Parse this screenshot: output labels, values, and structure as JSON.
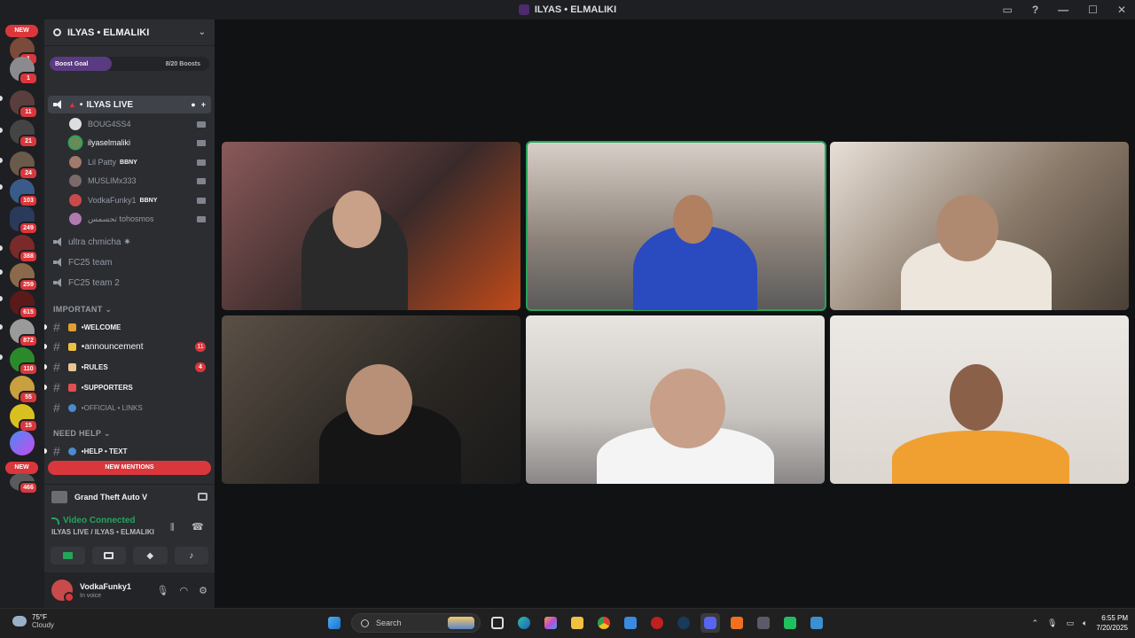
{
  "window": {
    "title": "ILYAS • ELMALIKI"
  },
  "guilds": {
    "new_top": "NEW",
    "new_bottom": "NEW",
    "badges": [
      "1",
      "1",
      "11",
      "21",
      "24",
      "103",
      "249",
      "388",
      "259",
      "615",
      "872",
      "110",
      "55",
      "15",
      "466"
    ]
  },
  "server": {
    "name": "ILYAS • ELMALIKI",
    "boost_label": "Boost Goal",
    "boost_count": "8/20 Boosts",
    "boost_progress": 0.4
  },
  "voice_channel": {
    "name": "ILYAS LIVE",
    "users": [
      {
        "name": "BOUG4SS4",
        "tag": ""
      },
      {
        "name": "ilyaselmaliki",
        "tag": ""
      },
      {
        "name": "Lil Patty",
        "tag": "BBNY"
      },
      {
        "name": "MUSLIMx333",
        "tag": ""
      },
      {
        "name": "VodkaFunky1",
        "tag": "BBNY"
      },
      {
        "name": "تحسمس tohosmos",
        "tag": ""
      }
    ]
  },
  "other_voice": [
    "ultra chmicha ✷",
    "FC25 team",
    "FC25 team 2"
  ],
  "categories": {
    "important": "IMPORTANT",
    "need_help": "NEED HELP"
  },
  "text_channels": [
    {
      "name": "WELCOME",
      "badge": ""
    },
    {
      "name": "announcement",
      "badge": "11"
    },
    {
      "name": "RULES",
      "badge": "4"
    },
    {
      "name": "SUPPORTERS",
      "badge": ""
    },
    {
      "name": "OFFICIAL • LINKS",
      "badge": ""
    },
    {
      "name": "HELP • TEXT",
      "badge": ""
    }
  ],
  "new_mentions": "NEW MENTIONS",
  "activity": {
    "game": "Grand Theft Auto V"
  },
  "rtc": {
    "status": "Video Connected",
    "channel": "ILYAS LIVE / ILYAS • ELMALIKI"
  },
  "user": {
    "name": "VodkaFunky1",
    "status": "In voice"
  },
  "taskbar": {
    "temp": "75°F",
    "condition": "Cloudy",
    "search_placeholder": "Search",
    "time": "6:55 PM",
    "date": "7/20/2025"
  },
  "colors": {
    "accent_green": "#23a55a",
    "mention_red": "#da373c",
    "sidebar": "#2b2d31"
  }
}
